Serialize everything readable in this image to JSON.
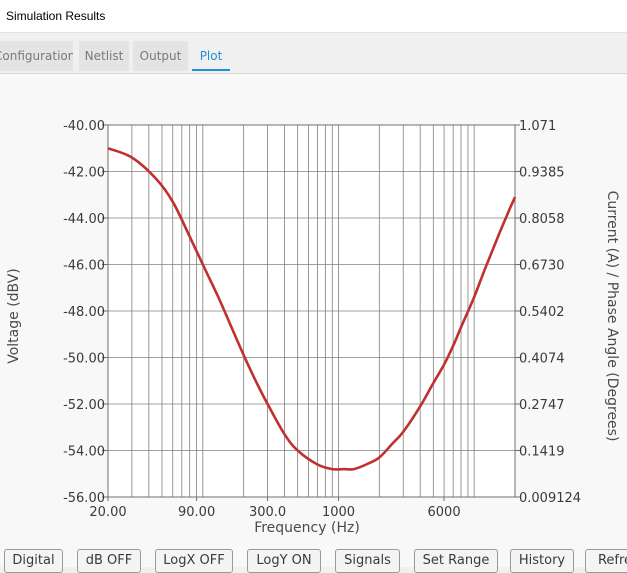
{
  "window": {
    "title": "Simulation Results"
  },
  "tabs": [
    {
      "label": "Configuration",
      "active": false
    },
    {
      "label": "Netlist",
      "active": false
    },
    {
      "label": "Output",
      "active": false
    },
    {
      "label": "Plot",
      "active": true
    }
  ],
  "buttons": [
    {
      "label": "Digital"
    },
    {
      "label": "dB OFF"
    },
    {
      "label": "LogX OFF"
    },
    {
      "label": "LogY ON"
    },
    {
      "label": "Signals"
    },
    {
      "label": "Set Range"
    },
    {
      "label": "History"
    },
    {
      "label": "Refre"
    }
  ],
  "colors": {
    "accent": "#1f8fd6",
    "trace": "#c0302e",
    "grid": "#808080"
  },
  "chart_data": {
    "type": "line",
    "xlabel": "Frequency (Hz)",
    "ylabel_left": "Voltage (dBV)",
    "ylabel_right": "Current (A) / Phase Angle (Degrees)",
    "x_scale": "log",
    "xlim": [
      20,
      20000
    ],
    "ylim_left": [
      -56,
      -40
    ],
    "ylim_right": [
      0.009124,
      1.071
    ],
    "x_tick_labels": [
      {
        "value": 20,
        "label": "20.00"
      },
      {
        "value": 90,
        "label": "90.00"
      },
      {
        "value": 300,
        "label": "300.0"
      },
      {
        "value": 1000,
        "label": "1000"
      },
      {
        "value": 6000,
        "label": "6000"
      }
    ],
    "y_tick_labels_left": [
      "-40.00",
      "-42.00",
      "-44.00",
      "-46.00",
      "-48.00",
      "-50.00",
      "-52.00",
      "-54.00",
      "-56.00"
    ],
    "y_tick_labels_right": [
      "1.071",
      "0.9385",
      "0.8058",
      "0.6730",
      "0.5402",
      "0.4074",
      "0.2747",
      "0.1419",
      "0.009124"
    ],
    "grid": true,
    "series": [
      {
        "x": [
          20,
          30,
          45,
          60,
          80,
          100,
          130,
          160,
          200,
          250,
          300,
          400,
          500,
          700,
          900,
          1100,
          1300,
          1600,
          2000,
          2500,
          3000,
          4000,
          5000,
          6000,
          7000,
          8000,
          10000,
          12000,
          15000,
          18000,
          20000
        ],
        "y": [
          -41.0,
          -41.4,
          -42.3,
          -43.3,
          -44.8,
          -46.0,
          -47.4,
          -48.6,
          -49.9,
          -51.1,
          -52.0,
          -53.3,
          -54.0,
          -54.6,
          -54.8,
          -54.8,
          -54.8,
          -54.6,
          -54.3,
          -53.7,
          -53.2,
          -52.1,
          -51.1,
          -50.3,
          -49.5,
          -48.7,
          -47.4,
          -46.2,
          -44.8,
          -43.7,
          -43.1
        ]
      }
    ]
  }
}
